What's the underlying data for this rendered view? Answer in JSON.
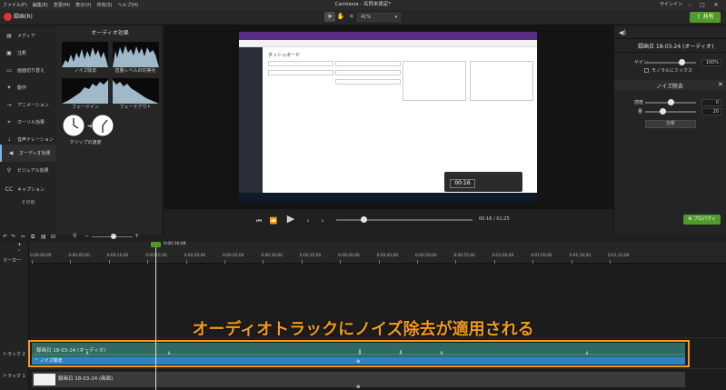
{
  "menu": [
    "ファイル(F)",
    "編集(E)",
    "変更(M)",
    "表示(V)",
    "共有(S)",
    "ヘルプ(H)"
  ],
  "app_title": "Camtasia - 名称未設定*",
  "signin": "サインイン",
  "window_controls": [
    "minimize",
    "maximize",
    "close"
  ],
  "toolbar": {
    "record_label": "録画(R)",
    "zoom": "41%",
    "share_label": "共有"
  },
  "sidebar": {
    "items": [
      {
        "label": "メディア",
        "icon": "film-icon"
      },
      {
        "label": "注釈",
        "icon": "annotation-icon"
      },
      {
        "label": "画面切り替え",
        "icon": "transition-icon"
      },
      {
        "label": "動作",
        "icon": "behavior-icon"
      },
      {
        "label": "アニメーション",
        "icon": "animation-icon"
      },
      {
        "label": "カーソル効果",
        "icon": "cursor-icon"
      },
      {
        "label": "音声ナレーション",
        "icon": "mic-icon"
      },
      {
        "label": "オーディオ効果",
        "icon": "speaker-icon"
      },
      {
        "label": "ビジュアル効果",
        "icon": "visual-icon"
      },
      {
        "label": "キャプション",
        "icon": "cc-icon"
      }
    ],
    "more": "その他"
  },
  "effects": {
    "title": "オーディオ効果",
    "items": [
      "ノイズ除去",
      "音量レベルの均等化",
      "フェードイン",
      "フェードアウト",
      "クリップの速度"
    ]
  },
  "playback": {
    "time": "00:16",
    "duration": "01:25"
  },
  "properties": {
    "clip_title": "録画日 18-03-24 (オーディオ)",
    "gain_label": "ゲイン",
    "gain_value": "100%",
    "gain_level": 0.72,
    "mono_label": "モノラルにミックス",
    "noise_title": "ノイズ除去",
    "sensitivity_label": "感度",
    "sensitivity_value": "0",
    "sensitivity_level": 0.5,
    "amount_label": "量",
    "amount_value": "20",
    "amount_level": 0.35,
    "analyze_label": "分析",
    "props_button": "プロパティ"
  },
  "timeline": {
    "marker_label": "マーカー",
    "playhead_time": "0:00:16;08",
    "ticks": [
      "0:00:00;00",
      "0:00:05;00",
      "0:00:10;00",
      "0:00:15;00",
      "0:00:20;00",
      "0:00:25;00",
      "0:00:30;00",
      "0:00:35;00",
      "0:00:40;00",
      "0:00:45;00",
      "0:00:50;00",
      "0:00:55;00",
      "0:01:00;00",
      "0:01:05;00",
      "0:01:10;00",
      "0:01:15;00"
    ],
    "track2_label": "トラック 2",
    "track1_label": "トラック 1",
    "clip2_name": "録画日 18-03-24 (オーディオ)",
    "noise_effect": "ノイズ除去",
    "clip1_name": "録画日 18-03-24 (画面)"
  },
  "callout": "オーディオトラックにノイズ除去が適用される",
  "canvas": {
    "heading": "ダッシュボード"
  },
  "colors": {
    "accent": "#4f9a2a",
    "highlight": "#f19a1c",
    "audio_clip": "#2f6a62",
    "effect_bar": "#2b84c6",
    "record": "#e0322b"
  }
}
